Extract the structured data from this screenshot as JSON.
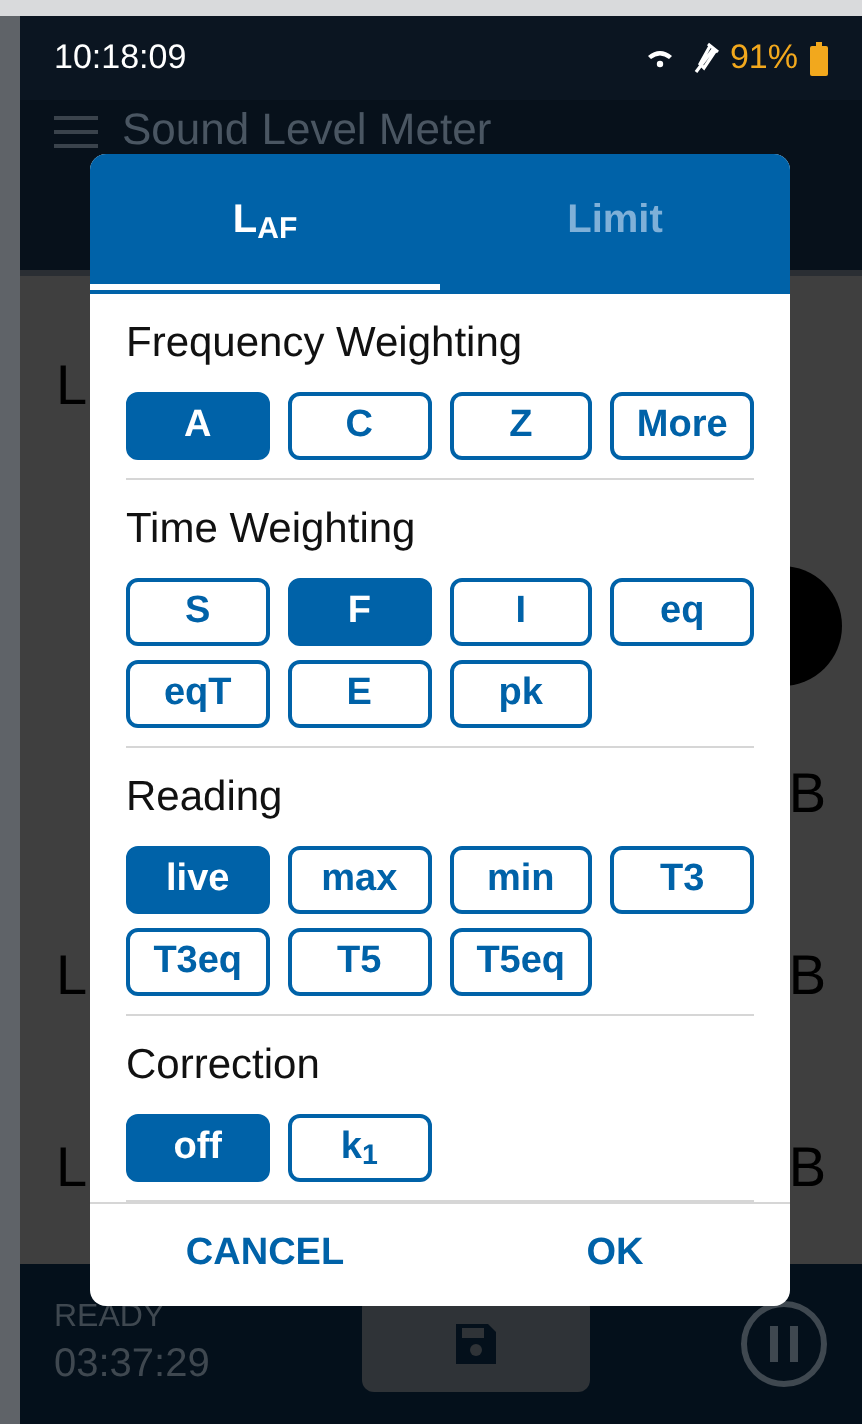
{
  "status_bar": {
    "time": "10:18:09",
    "battery": "91%"
  },
  "app_bar": {
    "title": "Sound Level Meter"
  },
  "background_rows": [
    {
      "label": "L"
    },
    {
      "unit": "B",
      "indicator": true
    },
    {
      "label": "L",
      "unit": "B"
    },
    {
      "label": "L",
      "unit": "B"
    }
  ],
  "footer": {
    "status": "READY",
    "elapsed": "03:37:29"
  },
  "dialog": {
    "tabs": [
      {
        "label": "L$_{AF}$",
        "selected": true
      },
      {
        "label": "Limit",
        "selected": false
      }
    ],
    "sections": [
      {
        "title": "Frequency Weighting",
        "options": [
          {
            "label": "A",
            "selected": true
          },
          {
            "label": "C",
            "selected": false
          },
          {
            "label": "Z",
            "selected": false
          },
          {
            "label": "More",
            "selected": false
          }
        ]
      },
      {
        "title": "Time Weighting",
        "options": [
          {
            "label": "S",
            "selected": false
          },
          {
            "label": "F",
            "selected": true
          },
          {
            "label": "I",
            "selected": false
          },
          {
            "label": "eq",
            "selected": false
          },
          {
            "label": "eqT",
            "selected": false
          },
          {
            "label": "E",
            "selected": false
          },
          {
            "label": "pk",
            "selected": false
          }
        ]
      },
      {
        "title": "Reading",
        "options": [
          {
            "label": "live",
            "selected": true
          },
          {
            "label": "max",
            "selected": false
          },
          {
            "label": "min",
            "selected": false
          },
          {
            "label": "T3",
            "selected": false
          },
          {
            "label": "T3eq",
            "selected": false
          },
          {
            "label": "T5",
            "selected": false
          },
          {
            "label": "T5eq",
            "selected": false
          }
        ]
      },
      {
        "title": "Correction",
        "options": [
          {
            "label": "off",
            "selected": true
          },
          {
            "label": "k$_{1}$",
            "selected": false
          }
        ]
      }
    ],
    "actions": [
      "CANCEL",
      "OK"
    ]
  }
}
